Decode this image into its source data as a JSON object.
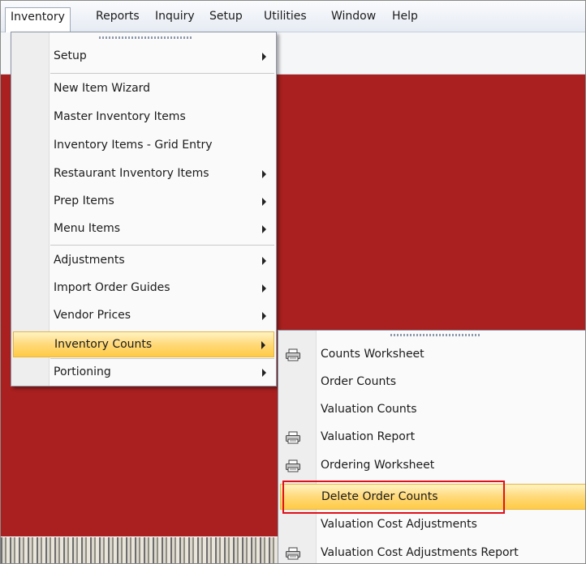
{
  "menubar": {
    "items": [
      {
        "label": "Inventory"
      },
      {
        "label": "Reports"
      },
      {
        "label": "Inquiry"
      },
      {
        "label": "Setup"
      },
      {
        "label": "Utilities"
      },
      {
        "label": "Window"
      },
      {
        "label": "Help"
      }
    ]
  },
  "inventory_menu": {
    "items": [
      {
        "label": "Setup",
        "submenu": true
      },
      {
        "label": "New Item Wizard"
      },
      {
        "label": "Master Inventory Items"
      },
      {
        "label": "Inventory Items - Grid Entry"
      },
      {
        "label": "Restaurant Inventory Items",
        "submenu": true
      },
      {
        "label": "Prep Items",
        "submenu": true
      },
      {
        "label": "Menu Items",
        "submenu": true
      },
      {
        "label": "Adjustments",
        "submenu": true
      },
      {
        "label": "Import Order Guides",
        "submenu": true
      },
      {
        "label": "Vendor Prices",
        "submenu": true
      },
      {
        "label": "Inventory Counts",
        "submenu": true,
        "highlighted": true
      },
      {
        "label": "Portioning",
        "submenu": true
      }
    ]
  },
  "counts_submenu": {
    "items": [
      {
        "label": "Counts Worksheet",
        "icon": "printer-icon"
      },
      {
        "label": "Order Counts"
      },
      {
        "label": "Valuation Counts"
      },
      {
        "label": "Valuation Report",
        "icon": "printer-icon"
      },
      {
        "label": "Ordering Worksheet",
        "icon": "printer-icon"
      },
      {
        "label": "Delete Order Counts",
        "highlighted": true
      },
      {
        "label": "Valuation Cost Adjustments"
      },
      {
        "label": "Valuation Cost Adjustments Report",
        "icon": "printer-icon"
      }
    ]
  },
  "colors": {
    "workspace": "#aa2020",
    "highlight": "#ffd97a",
    "annotation_box": "#e0101a"
  }
}
